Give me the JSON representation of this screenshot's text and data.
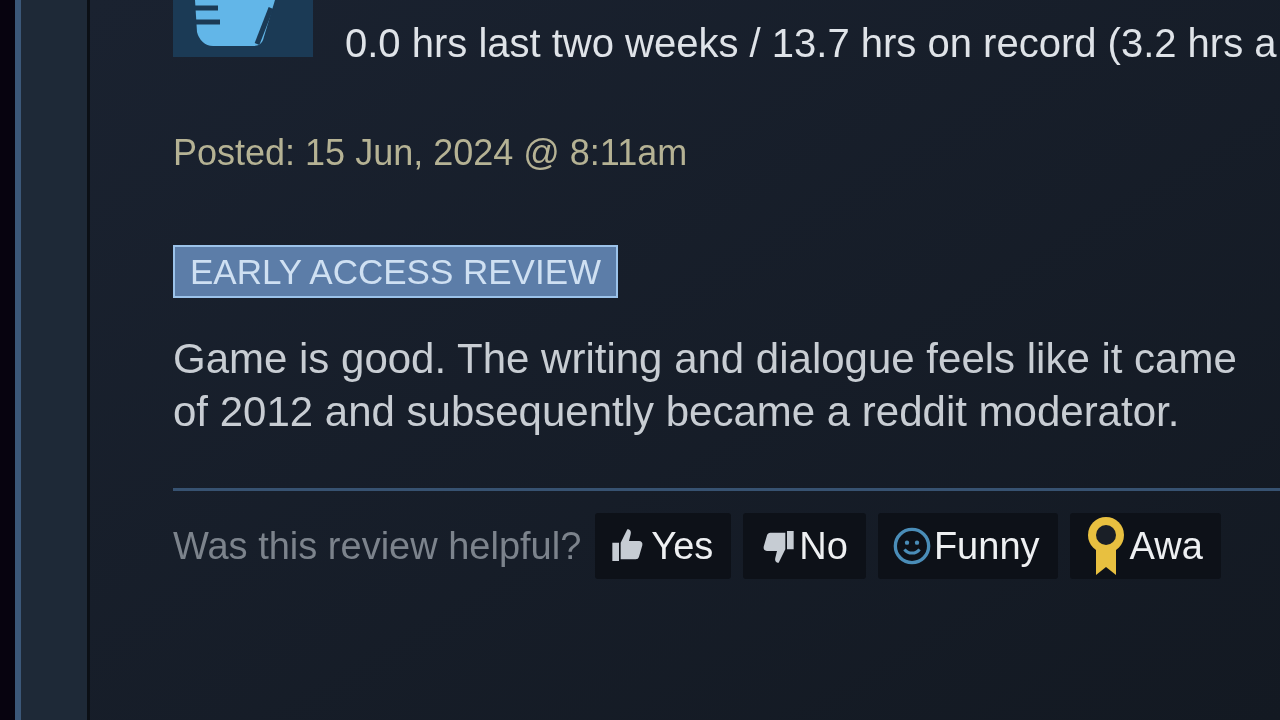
{
  "review": {
    "hours": "0.0 hrs last two weeks / 13.7 hrs on record (3.2 hrs a",
    "posted": "Posted: 15 Jun, 2024 @ 8:11am",
    "badge": "EARLY ACCESS REVIEW",
    "body_lines": [
      "Game is good. The writing and dialogue feels like it came",
      "of 2012 and subsequently became a reddit moderator."
    ],
    "helpful_prompt": "Was this review helpful?",
    "buttons": [
      {
        "kind": "yes",
        "label": "Yes"
      },
      {
        "kind": "no",
        "label": "No"
      },
      {
        "kind": "funny",
        "label": "Funny"
      },
      {
        "kind": "award",
        "label": "Awa"
      }
    ]
  }
}
